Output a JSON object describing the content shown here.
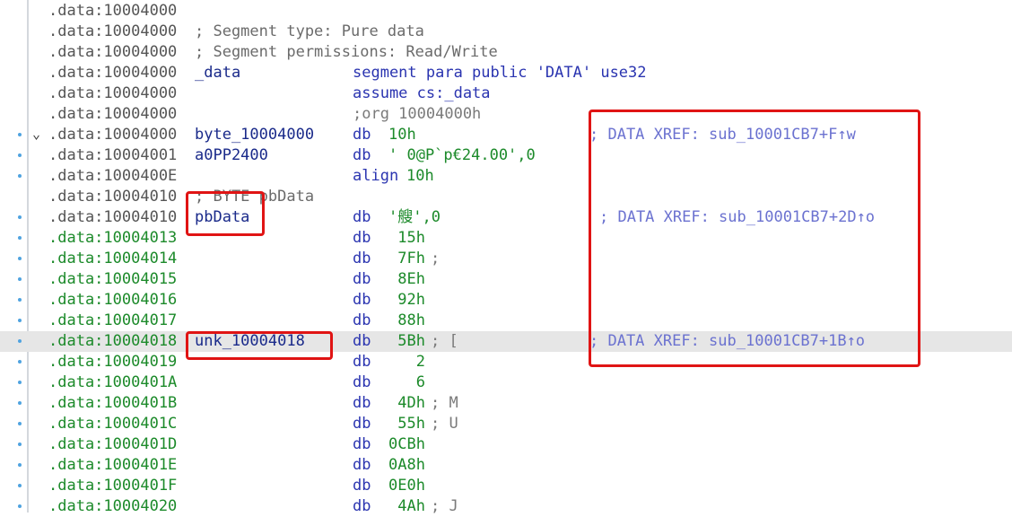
{
  "colors": {
    "background": "#ffffff",
    "address": "#1c8a2a",
    "address_header": "#555555",
    "keyword": "#2a34b0",
    "name": "#1a2a8a",
    "comment": "#6b6b6b",
    "xref": "#6b72d0",
    "highlight_box": "#e01414",
    "row_highlight": "#e6e6e6",
    "gutter_dot": "#4fa3e0"
  },
  "lines": [
    {
      "addr": ".data:10004000",
      "addr_style": "header"
    },
    {
      "addr": ".data:10004000",
      "addr_style": "header",
      "comment": "; Segment type: Pure data"
    },
    {
      "addr": ".data:10004000",
      "addr_style": "header",
      "comment": "; Segment permissions: Read/Write"
    },
    {
      "addr": ".data:10004000",
      "addr_style": "header",
      "name": "_data",
      "instr": "segment para public 'DATA' use32"
    },
    {
      "addr": ".data:10004000",
      "addr_style": "header",
      "instr": "assume cs:_data"
    },
    {
      "addr": ".data:10004000",
      "addr_style": "header",
      "instr": ";org 10004000h"
    },
    {
      "addr": ".data:10004000",
      "addr_style": "header",
      "name": "byte_10004000",
      "op": "db",
      "arg": "10h",
      "xref": "; DATA XREF: sub_10001CB7+F↑w",
      "dot": true,
      "chevron": true
    },
    {
      "addr": ".data:10004001",
      "addr_style": "header",
      "name": "a0PP2400",
      "op": "db",
      "arg": "' 0@P`p€24.00',0",
      "dot": true
    },
    {
      "addr": ".data:1000400E",
      "addr_style": "header",
      "op": "align",
      "arg": "10h",
      "dot": true
    },
    {
      "addr": ".data:10004010",
      "addr_style": "header",
      "comment": "; BYTE pbData"
    },
    {
      "addr": ".data:10004010",
      "addr_style": "header",
      "name": "pbData",
      "op": "db",
      "arg": "'艘',0",
      "xref": "; DATA XREF: sub_10001CB7+2D↑o",
      "dot": true
    },
    {
      "addr": ".data:10004013",
      "addr_style": "code",
      "op": "db",
      "arg": " 15h",
      "dot": true
    },
    {
      "addr": ".data:10004014",
      "addr_style": "code",
      "op": "db",
      "arg": " 7Fh",
      "trail": ";",
      "dot": true
    },
    {
      "addr": ".data:10004015",
      "addr_style": "code",
      "op": "db",
      "arg": " 8Eh",
      "dot": true
    },
    {
      "addr": ".data:10004016",
      "addr_style": "code",
      "op": "db",
      "arg": " 92h",
      "dot": true
    },
    {
      "addr": ".data:10004017",
      "addr_style": "code",
      "op": "db",
      "arg": " 88h",
      "dot": true
    },
    {
      "addr": ".data:10004018",
      "addr_style": "code",
      "name": "unk_10004018",
      "op": "db",
      "arg": " 5Bh",
      "trail": "; [",
      "xref": "; DATA XREF: sub_10001CB7+1B↑o",
      "dot": true,
      "highlight": true
    },
    {
      "addr": ".data:10004019",
      "addr_style": "code",
      "op": "db",
      "arg": "   2",
      "dot": true
    },
    {
      "addr": ".data:1000401A",
      "addr_style": "code",
      "op": "db",
      "arg": "   6",
      "dot": true
    },
    {
      "addr": ".data:1000401B",
      "addr_style": "code",
      "op": "db",
      "arg": " 4Dh",
      "trail": "; M",
      "dot": true
    },
    {
      "addr": ".data:1000401C",
      "addr_style": "code",
      "op": "db",
      "arg": " 55h",
      "trail": "; U",
      "dot": true
    },
    {
      "addr": ".data:1000401D",
      "addr_style": "code",
      "op": "db",
      "arg": "0CBh",
      "dot": true
    },
    {
      "addr": ".data:1000401E",
      "addr_style": "code",
      "op": "db",
      "arg": "0A8h",
      "dot": true
    },
    {
      "addr": ".data:1000401F",
      "addr_style": "code",
      "op": "db",
      "arg": "0E0h",
      "dot": true
    },
    {
      "addr": ".data:10004020",
      "addr_style": "code",
      "op": "db",
      "arg": " 4Ah",
      "trail": "; J",
      "dot": true
    }
  ]
}
